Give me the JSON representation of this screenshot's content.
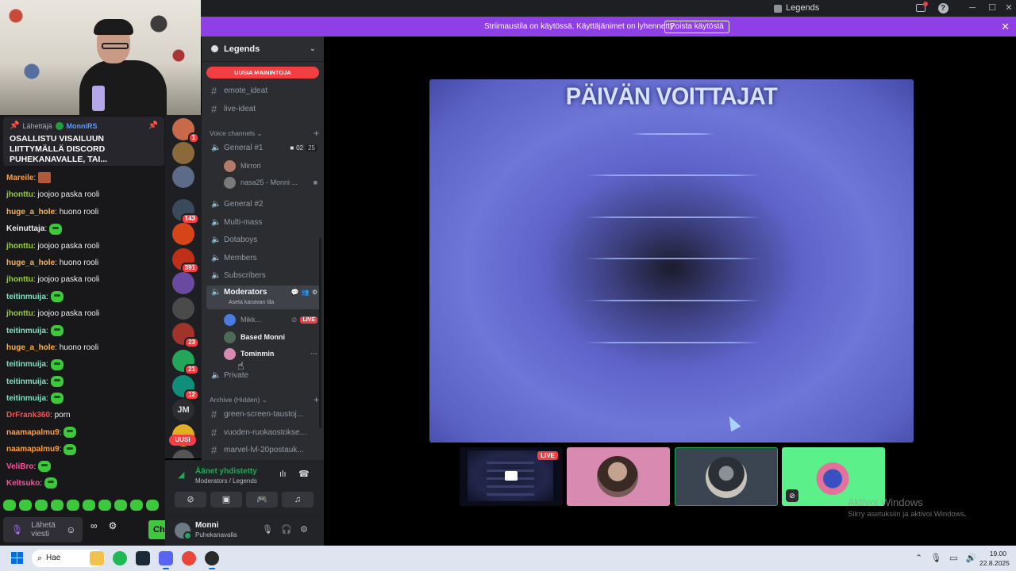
{
  "window": {
    "title": "Legends"
  },
  "banner": {
    "text": "Striimaustila on käytössä. Käyttäjänimet on lyhennetty.",
    "button": "Poista käytöstä"
  },
  "stream_chat": {
    "pinned": {
      "by_label": "Lähettäjä",
      "by_user": "MonniRS",
      "message": "OSALLISTU VISAILUUN LIITTYMÄLLÄ DISCORD PUHEKANAVALLE, TAI..."
    },
    "messages": [
      {
        "user": "Mareile",
        "color": "#ff9f40",
        "text": ""
      },
      {
        "user": "jhonttu",
        "color": "#9acd32",
        "text": "joojoo paska rooli"
      },
      {
        "user": "huge_a_hole",
        "color": "#ffb347",
        "text": "huono rooli"
      },
      {
        "user": "Keinuttaja",
        "color": "#efeff1",
        "text": ""
      },
      {
        "user": "jhonttu",
        "color": "#9acd32",
        "text": "joojoo paska rooli"
      },
      {
        "user": "huge_a_hole",
        "color": "#ffb347",
        "text": "huono rooli"
      },
      {
        "user": "jhonttu",
        "color": "#9acd32",
        "text": "joojoo paska rooli"
      },
      {
        "user": "teitinmuija",
        "color": "#7fe0c0",
        "text": ""
      },
      {
        "user": "jhonttu",
        "color": "#9acd32",
        "text": "joojoo paska rooli"
      },
      {
        "user": "teitinmuija",
        "color": "#7fe0c0",
        "text": ""
      },
      {
        "user": "huge_a_hole",
        "color": "#ffb347",
        "text": "huono rooli"
      },
      {
        "user": "teitinmuija",
        "color": "#7fe0c0",
        "text": ""
      },
      {
        "user": "teitinmuija",
        "color": "#7fe0c0",
        "text": ""
      },
      {
        "user": "teitinmuija",
        "color": "#7fe0c0",
        "text": ""
      },
      {
        "user": "DrFrank360",
        "color": "#ff4f4f",
        "text": "porn"
      },
      {
        "user": "naamapalmu9",
        "color": "#ff9f40",
        "text": ""
      },
      {
        "user": "naamapalmu9",
        "color": "#ff9f40",
        "text": ""
      },
      {
        "user": "VeliBro",
        "color": "#ff4f9f",
        "text": ""
      },
      {
        "user": "Keltsuko",
        "color": "#ff4f9f",
        "text": ""
      }
    ],
    "input_placeholder": "Lähetä viesti",
    "send_label": "Ch"
  },
  "server_rail": {
    "badges": [
      "1",
      "143",
      "391",
      "23",
      "21",
      "12"
    ],
    "jm": "JM",
    "new_label": "UUSI"
  },
  "server": {
    "name": "Legends",
    "mentions_pill": "UUSIA MAININTOJA",
    "text_channels_top": [
      "emote_ideat",
      "live-ideat"
    ],
    "voice_category": "Voice channels",
    "general1": {
      "name": "General #1",
      "video_count": "02",
      "user_count": "25"
    },
    "general1_users": [
      "Mirrori",
      "nasa25 - Monni ..."
    ],
    "voice_channels": [
      "General #2",
      "Multi-mass",
      "Dotaboys",
      "Members",
      "Subscribers"
    ],
    "moderators": {
      "name": "Moderators",
      "sub": "Aseta kanavan tila"
    },
    "moderators_users": [
      {
        "name": "Mikk...",
        "live": "LIVE"
      },
      {
        "name": "Based Monni"
      },
      {
        "name": "Tominmin"
      }
    ],
    "private_channel": "Private",
    "archive_category": "Archive (Hidden)",
    "archive_channels": [
      "green-screen-taustoj...",
      "vuoden-ruokaostokse...",
      "marvel-lvl-20postauk..."
    ]
  },
  "voice_panel": {
    "status": "Äänet yhdistetty",
    "path": "Moderators / Legends"
  },
  "user": {
    "name": "Monni",
    "status": "Puhekanavalla"
  },
  "stage": {
    "headline": "PÄIVÄN VOITTAJAT",
    "tile1_live": "LIVE"
  },
  "watermark": {
    "line1": "Aktivoi Windows",
    "line2": "Siirry asetuksiin ja aktivoi Windows."
  },
  "taskbar": {
    "search": "Hae",
    "time": "19.00",
    "date": "22.8.2025"
  },
  "colors": {
    "discord_bg": "#2b2d31",
    "rail_bg": "#1e1f22",
    "banner": "#8f3fe6",
    "danger": "#f23f43",
    "online": "#23a55a",
    "twitch_bg": "#18181b"
  }
}
